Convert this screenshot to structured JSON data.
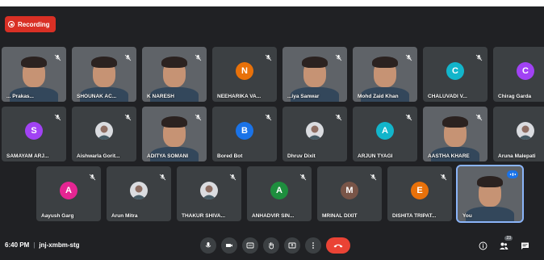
{
  "recording": {
    "label": "Recording"
  },
  "rows": [
    [
      {
        "name": "... Prakas...",
        "kind": "video"
      },
      {
        "name": "SHOUNAK AC...",
        "kind": "video"
      },
      {
        "name": "K NARESH",
        "kind": "video"
      },
      {
        "name": "NEEHARIKA VA...",
        "kind": "avatar",
        "initial": "N",
        "color": "#e8710a"
      },
      {
        "name": "...iya Sanwar",
        "kind": "video"
      },
      {
        "name": "Mohd Zaid Khan",
        "kind": "video"
      },
      {
        "name": "CHALUVADI V...",
        "kind": "avatar",
        "initial": "C",
        "color": "#12b5cb"
      },
      {
        "name": "Chirag Garda",
        "kind": "avatar",
        "initial": "C",
        "color": "#a142f4"
      }
    ],
    [
      {
        "name": "SAMAYAM ARJ...",
        "kind": "avatar",
        "initial": "S",
        "color": "#a142f4"
      },
      {
        "name": "Aishwarla Gorit...",
        "kind": "photo"
      },
      {
        "name": "ADITYA SOMANI",
        "kind": "video"
      },
      {
        "name": "Bored Bot",
        "kind": "avatar",
        "initial": "B",
        "color": "#1a73e8"
      },
      {
        "name": "Dhruv Dixit",
        "kind": "photo"
      },
      {
        "name": "ARJUN TYAGI",
        "kind": "avatar",
        "initial": "A",
        "color": "#12b5cb"
      },
      {
        "name": "AASTHA KHARE",
        "kind": "video"
      },
      {
        "name": "Aruna Malepati",
        "kind": "photo"
      }
    ],
    [
      {
        "name": "Aayush Garg",
        "kind": "avatar",
        "initial": "A",
        "color": "#e52592"
      },
      {
        "name": "Arun Mitra",
        "kind": "photo"
      },
      {
        "name": "THAKUR SHIVA...",
        "kind": "photo"
      },
      {
        "name": "ANHADVIR SIN...",
        "kind": "avatar",
        "initial": "A",
        "color": "#1e8e3e"
      },
      {
        "name": "MRINAL DIXIT",
        "kind": "avatar",
        "initial": "M",
        "color": "#795548"
      },
      {
        "name": "DISHITA TRIPAT...",
        "kind": "avatar",
        "initial": "E",
        "color": "#e8710a"
      },
      {
        "name": "You",
        "kind": "video",
        "active": true
      }
    ]
  ],
  "footer": {
    "time": "6:40 PM",
    "separator": "|",
    "meeting_code": "jnj-xmbm-stg",
    "people_count": "23"
  },
  "colors": {
    "end_call": "#ea4335",
    "record": "#d93025",
    "bg": "#202124",
    "tile": "#3c4043"
  }
}
